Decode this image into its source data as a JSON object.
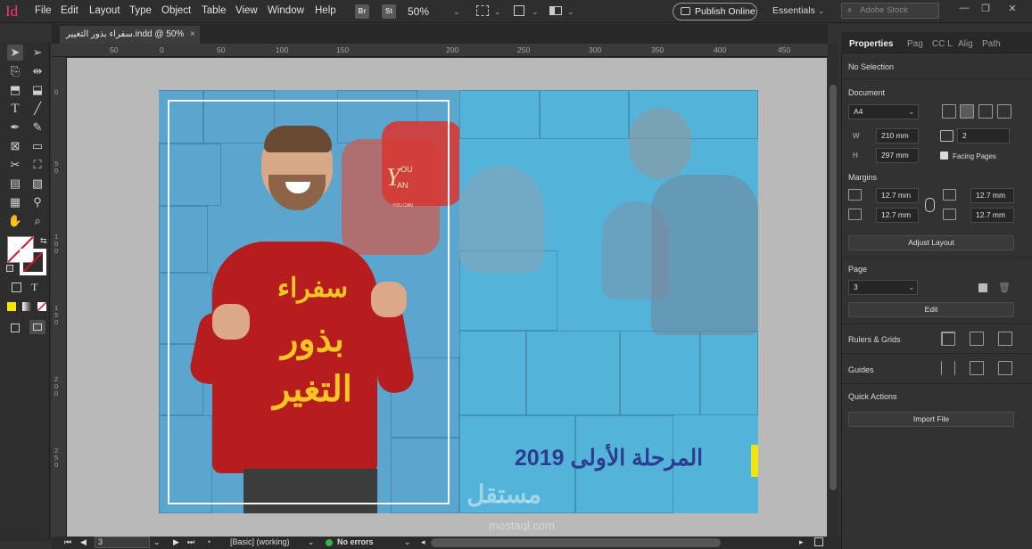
{
  "app": {
    "logo": "Id"
  },
  "menu": [
    "File",
    "Edit",
    "Layout",
    "Type",
    "Object",
    "Table",
    "View",
    "Window",
    "Help"
  ],
  "toolbar": {
    "bridge": "Br",
    "stock_btn": "St",
    "zoom": "50%",
    "publish": "Publish Online",
    "workspace": "Essentials",
    "search_placeholder": "Adobe Stock"
  },
  "document_tab": {
    "title": "سفراء بذور التغيير.indd @ 50%",
    "close": "×"
  },
  "ruler_top": [
    "50",
    "0",
    "50",
    "100",
    "150",
    "200",
    "250",
    "300",
    "350",
    "400",
    "450"
  ],
  "ruler_left": [
    "0",
    "50",
    "100",
    "150",
    "200",
    "250"
  ],
  "artwork": {
    "logo_line1": "OU",
    "logo_line2": "AN",
    "logo_small": "YOU CAN",
    "headline_1": "سفراء",
    "headline_2": "بذور",
    "headline_3": "التغير",
    "subtitle": "المرحلة الأولى 2019",
    "watermark": "مستقل",
    "watermark_url": "mostaql.com"
  },
  "panel": {
    "tabs": [
      "Properties",
      "Pag",
      "CC L",
      "Alig",
      "Path"
    ],
    "selection": "No Selection",
    "document_label": "Document",
    "page_size": "A4",
    "width_label": "W",
    "width": "210 mm",
    "height_label": "H",
    "height": "297 mm",
    "pages": "2",
    "facing_pages": "Facing Pages",
    "margins_label": "Margins",
    "margin_top": "12.7 mm",
    "margin_bottom": "12.7 mm",
    "margin_inside": "12.7 mm",
    "margin_outside": "12.7 mm",
    "adjust_layout": "Adjust Layout",
    "page_label": "Page",
    "page_value": "3",
    "edit": "Edit",
    "rulers_grids": "Rulers & Grids",
    "guides": "Guides",
    "quick_actions": "Quick Actions",
    "import_file": "Import File"
  },
  "status": {
    "page": "3",
    "style": "[Basic] (working)",
    "errors": "No errors"
  }
}
